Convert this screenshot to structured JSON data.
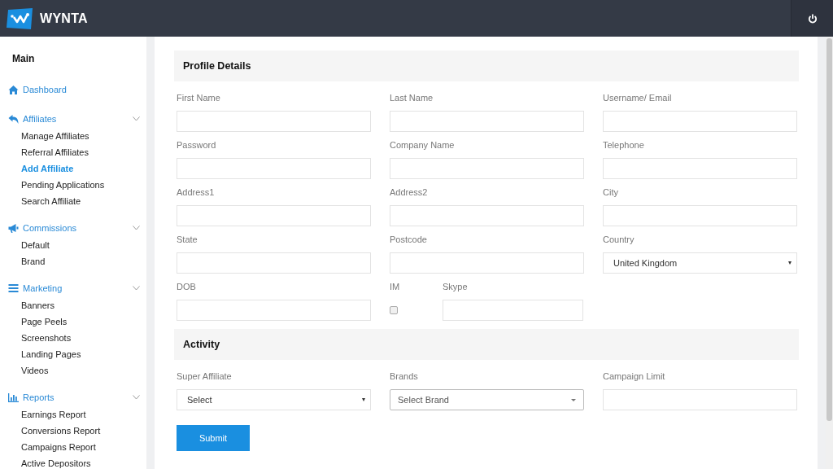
{
  "header": {
    "brand": "WYNTA"
  },
  "sidebar": {
    "title": "Main",
    "groups": [
      {
        "label": "Dashboard"
      },
      {
        "label": "Affiliates",
        "expanded": true,
        "children": [
          {
            "label": "Manage Affiliates",
            "selected": false
          },
          {
            "label": "Referral Affiliates",
            "selected": false
          },
          {
            "label": "Add Affiliate",
            "selected": true
          },
          {
            "label": "Pending Applications",
            "selected": false
          },
          {
            "label": "Search Affiliate",
            "selected": false
          }
        ]
      },
      {
        "label": "Commissions",
        "expanded": true,
        "children": [
          {
            "label": "Default",
            "selected": false
          },
          {
            "label": "Brand",
            "selected": false
          }
        ]
      },
      {
        "label": "Marketing",
        "expanded": true,
        "children": [
          {
            "label": "Banners",
            "selected": false
          },
          {
            "label": "Page Peels",
            "selected": false
          },
          {
            "label": "Screenshots",
            "selected": false
          },
          {
            "label": "Landing Pages",
            "selected": false
          },
          {
            "label": "Videos",
            "selected": false
          }
        ]
      },
      {
        "label": "Reports",
        "expanded": true,
        "children": [
          {
            "label": "Earnings Report",
            "selected": false
          },
          {
            "label": "Conversions Report",
            "selected": false
          },
          {
            "label": "Campaigns Report",
            "selected": false
          },
          {
            "label": "Active Depositors",
            "selected": false
          }
        ]
      }
    ]
  },
  "sections": [
    {
      "title": "Profile Details",
      "rows": [
        [
          {
            "kind": "text",
            "label": "First Name"
          },
          {
            "kind": "text",
            "label": "Last Name"
          },
          {
            "kind": "text",
            "label": "Username/ Email"
          }
        ],
        [
          {
            "kind": "text",
            "label": "Password"
          },
          {
            "kind": "text",
            "label": "Company Name"
          },
          {
            "kind": "text",
            "label": "Telephone"
          }
        ],
        [
          {
            "kind": "text",
            "label": "Address1"
          },
          {
            "kind": "text",
            "label": "Address2"
          },
          {
            "kind": "text",
            "label": "City"
          }
        ],
        [
          {
            "kind": "text",
            "label": "State"
          },
          {
            "kind": "text",
            "label": "Postcode"
          },
          {
            "kind": "select",
            "label": "Country",
            "value": "United Kingdom"
          }
        ],
        [
          {
            "kind": "text",
            "label": "DOB"
          },
          {
            "kind": "checkbox",
            "label": "IM",
            "checked": false
          },
          {
            "kind": "text",
            "label": "Skype"
          }
        ]
      ]
    },
    {
      "title": "Activity",
      "rows": [
        [
          {
            "kind": "select",
            "label": "Super Affiliate",
            "value": "Select"
          },
          {
            "kind": "dropdown",
            "label": "Brands",
            "value": "Select Brand"
          },
          {
            "kind": "text",
            "label": "Campaign Limit"
          }
        ]
      ]
    }
  ],
  "submit": "Submit"
}
